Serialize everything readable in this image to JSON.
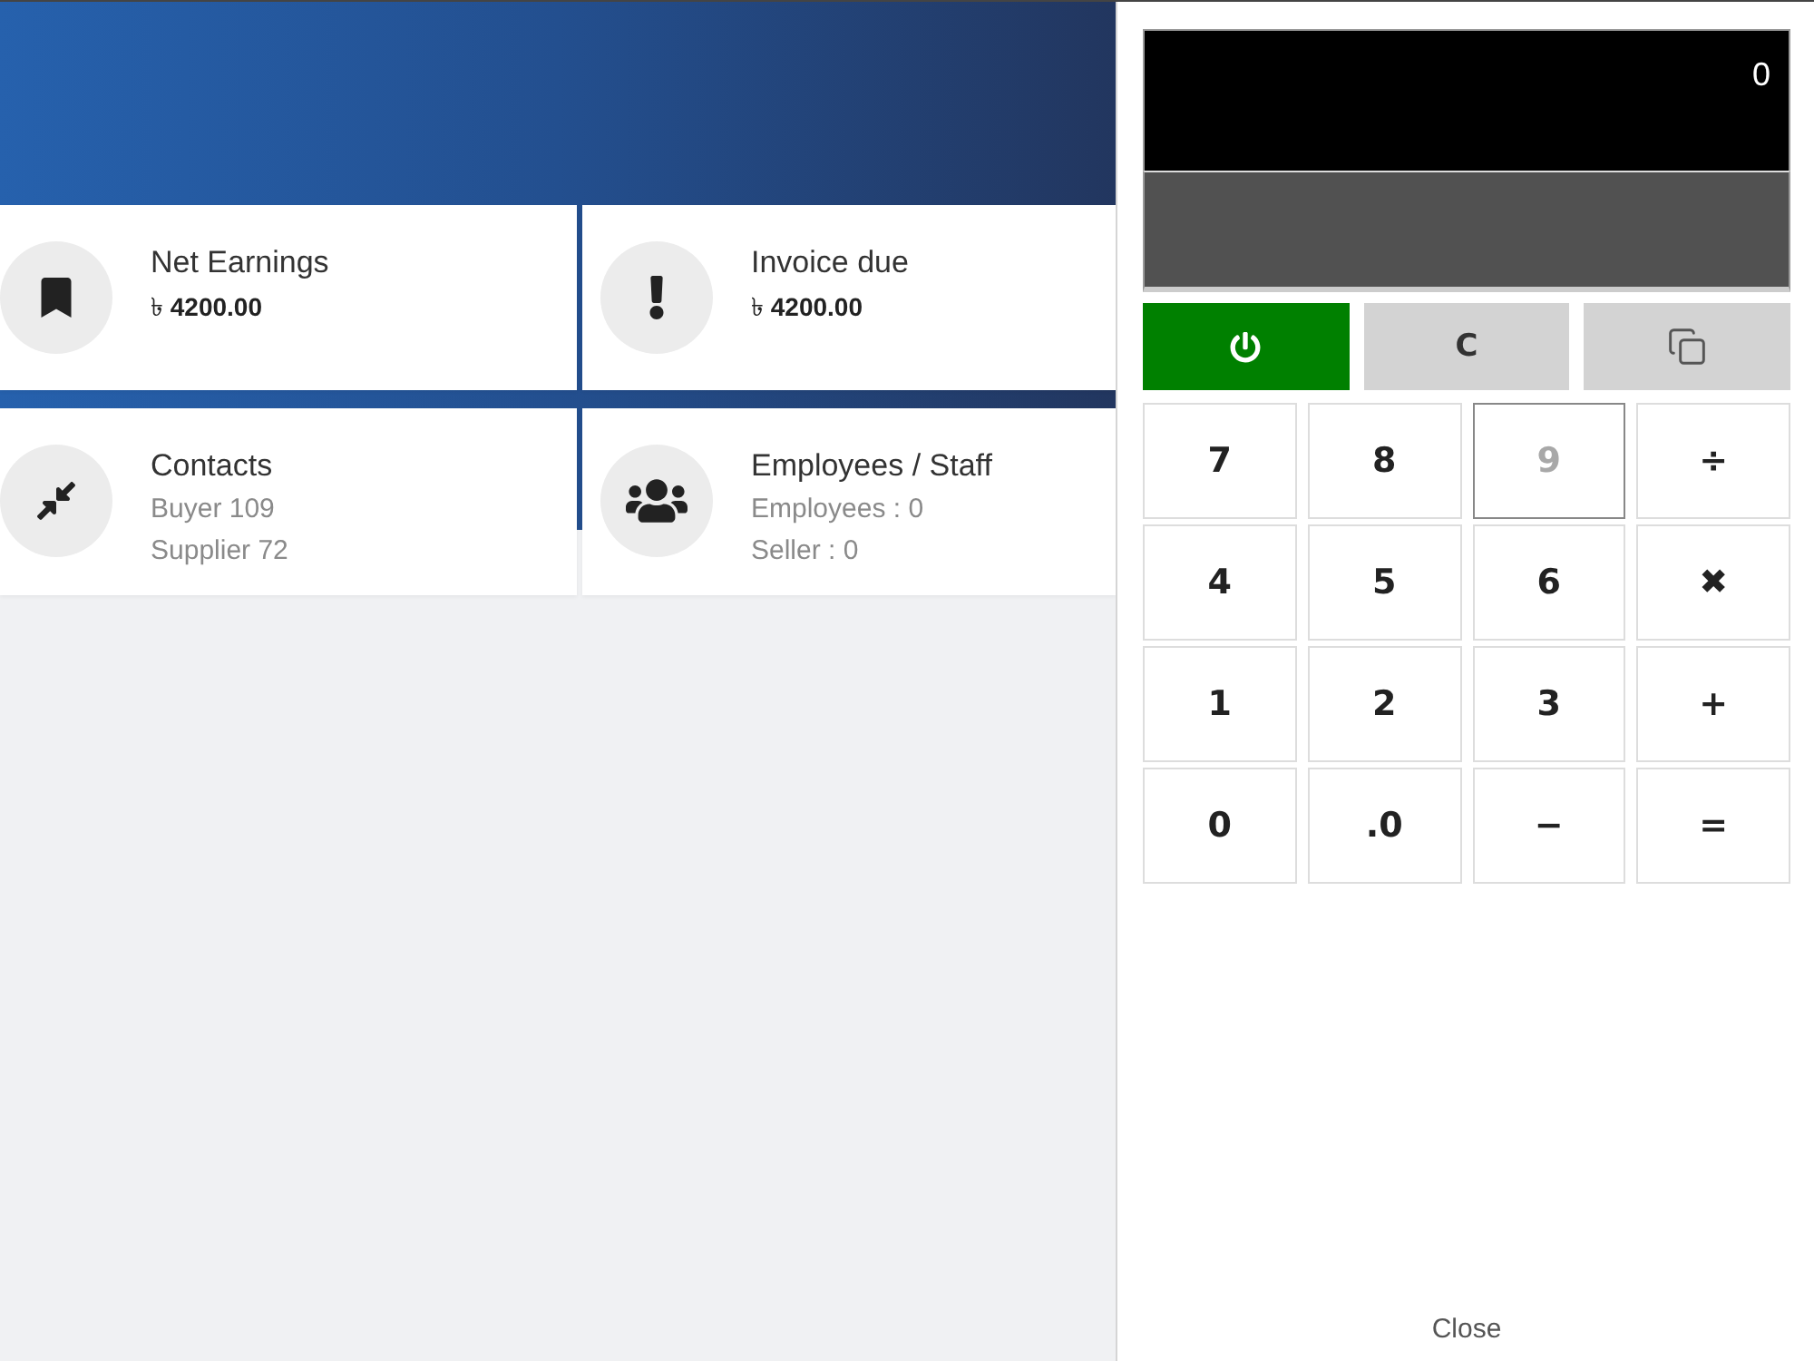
{
  "dashboard": {
    "cards": [
      {
        "kind": "amount",
        "title": "Net Earnings",
        "amount": "৳ **4200.00**"
      },
      {
        "kind": "amount",
        "title": "Invoice due",
        "amount": "৳ **4200.00**"
      },
      {
        "kind": "list",
        "title": "Contacts",
        "lines": [
          "Buyer 109",
          "Supplier 72"
        ]
      },
      {
        "kind": "list",
        "title": "Employees / Staff",
        "lines": [
          "Employees : 0",
          "Seller : 0"
        ]
      }
    ]
  },
  "calculator": {
    "display": {
      "value": "0"
    },
    "controls": [
      {
        "kind": "power",
        "on": true
      },
      {
        "kind": "clear",
        "label": "C"
      },
      {
        "kind": "copy"
      }
    ],
    "keys": [
      {
        "label": "7",
        "focused": false
      },
      {
        "label": "8",
        "focused": false
      },
      {
        "label": "9",
        "focused": true
      },
      {
        "label": "÷",
        "focused": false
      },
      {
        "label": "4",
        "focused": false
      },
      {
        "label": "5",
        "focused": false
      },
      {
        "label": "6",
        "focused": false
      },
      {
        "label": "✖",
        "focused": false
      },
      {
        "label": "1",
        "focused": false
      },
      {
        "label": "2",
        "focused": false
      },
      {
        "label": "3",
        "focused": false
      },
      {
        "label": "+",
        "focused": false
      },
      {
        "label": "0",
        "focused": false
      },
      {
        "label": ".0",
        "focused": false
      },
      {
        "label": "−",
        "focused": false
      },
      {
        "label": "=",
        "focused": false
      }
    ],
    "close": "Close"
  }
}
